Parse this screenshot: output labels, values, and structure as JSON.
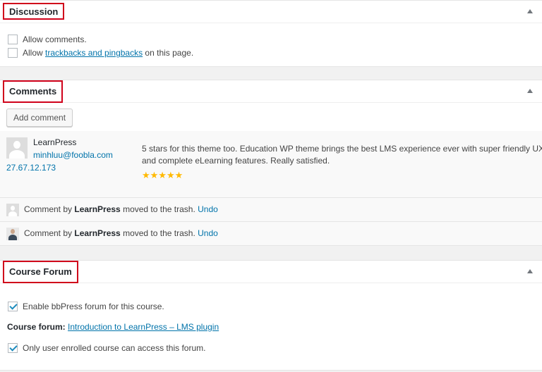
{
  "discussion": {
    "title": "Discussion",
    "allow_comments": {
      "label": "Allow comments.",
      "checked": false
    },
    "allow_trackbacks": {
      "prefix": "Allow ",
      "link": "trackbacks and pingbacks",
      "suffix": " on this page.",
      "checked": false
    }
  },
  "comments": {
    "title": "Comments",
    "add_button": "Add comment",
    "items": [
      {
        "author": "LearnPress",
        "email": "minhluu@foobla.com",
        "ip": "27.67.12.173",
        "text_line1": "5 stars for this theme too. Education WP theme brings the best LMS experience ever with super friendly UX",
        "text_line2": "and complete eLearning features. Really satisfied.",
        "rating": "★★★★★"
      }
    ],
    "trash_notices": [
      {
        "prefix": "Comment by ",
        "author": "LearnPress",
        "suffix": " moved to the trash. ",
        "undo": "Undo"
      },
      {
        "prefix": "Comment by ",
        "author": "LearnPress",
        "suffix": " moved to the trash. ",
        "undo": "Undo"
      }
    ]
  },
  "course_forum": {
    "title": "Course Forum",
    "enable": {
      "label": "Enable bbPress forum for this course.",
      "checked": true
    },
    "forum_label": "Course forum:",
    "forum_link": "Introduction to LearnPress – LMS plugin",
    "restrict": {
      "label": "Only user enrolled course can access this forum.",
      "checked": true
    }
  },
  "colors": {
    "accent_link": "#0073aa",
    "highlight_box": "#d0021b",
    "star": "#ffb900",
    "checkmark": "#1e8cbe"
  }
}
